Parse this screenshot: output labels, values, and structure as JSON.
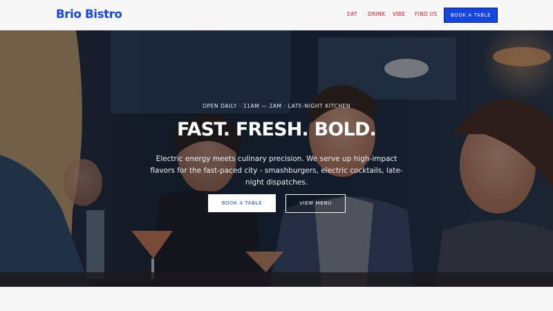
{
  "brand": {
    "name": "Brio Bistro",
    "accent": "#1646e0",
    "nav_color": "#d8192b"
  },
  "nav": {
    "items": [
      {
        "label": "EAT"
      },
      {
        "label": "DRINK"
      },
      {
        "label": "VIBE"
      },
      {
        "label": "FIND US"
      }
    ],
    "cta_label": "BOOK A TABLE"
  },
  "hero": {
    "eyebrow": "OPEN DAILY · 11AM — 2AM · LATE-NIGHT KITCHEN",
    "title": "FAST. FRESH. BOLD.",
    "description": "Electric energy meets culinary precision. We serve up high-impact flavors for the fast-paced city - smashburgers, electric cocktails, late-night dispatches.",
    "primary_button": "BOOK A TABLE",
    "secondary_button": "VIEW MENU",
    "background_image": "restaurant-diners-photo"
  }
}
